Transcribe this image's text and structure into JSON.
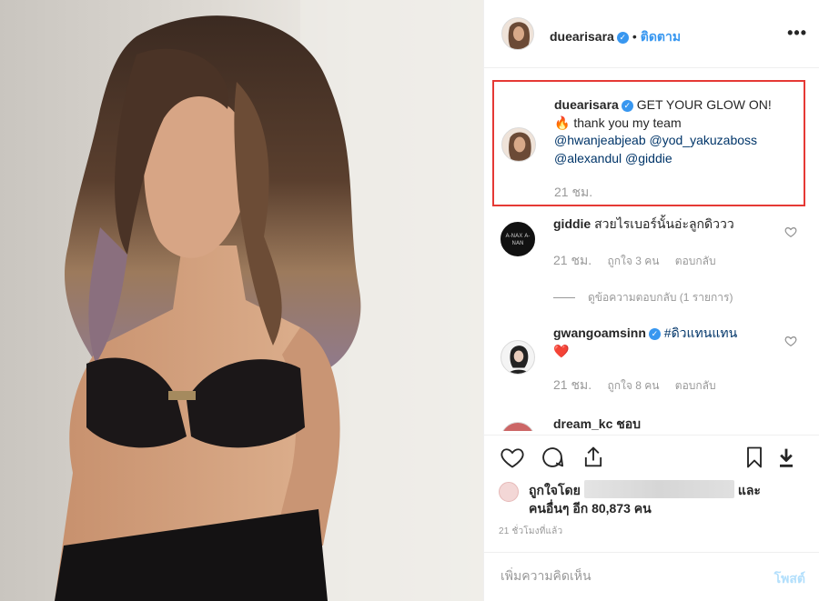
{
  "post": {
    "image_alt": "photo-of-woman",
    "author": "duearisara",
    "follow_label": "ติดตาม",
    "more_label": "•••"
  },
  "caption": {
    "username": "duearisara",
    "line1": "GET YOUR GLOW ON!",
    "line2_emoji": "🔥",
    "line2": "thank you my team",
    "mentions": [
      "@hwanjeabjeab",
      "@yod_yakuzaboss",
      "@alexandul",
      "@giddie"
    ],
    "time": "21 ชม."
  },
  "comments": [
    {
      "username": "giddie",
      "avatar_text": "A-NAX A-NAN",
      "text": "สวยไรเบอร์นั้นอ่ะลูกดิววว",
      "time": "21 ชม.",
      "likes": "ถูกใจ 3 คน",
      "reply": "ตอบกลับ",
      "view_replies": "ดูข้อความตอบกลับ (1 รายการ)"
    },
    {
      "username": "gwangoamsinn",
      "text": "#ดิวแทนแทน",
      "emoji": "❤️",
      "time": "21 ชม.",
      "likes": "ถูกใจ 8 คน",
      "reply": "ตอบกลับ"
    },
    {
      "username": "dream_kc ชอบ"
    }
  ],
  "likes": {
    "prefix": "ถูกใจโดย",
    "suffix": "และ",
    "line2": "คนอื่นๆ อีก 80,873 คน"
  },
  "post_time": "21 ชั่วโมงที่แล้ว",
  "add_comment": {
    "placeholder": "เพิ่มความคิดเห็น",
    "post_label": "โพสต์"
  },
  "colors": {
    "accent": "#3897f0",
    "highlight_border": "#e53935",
    "heart_red": "#ed4956",
    "muted": "#999999"
  }
}
